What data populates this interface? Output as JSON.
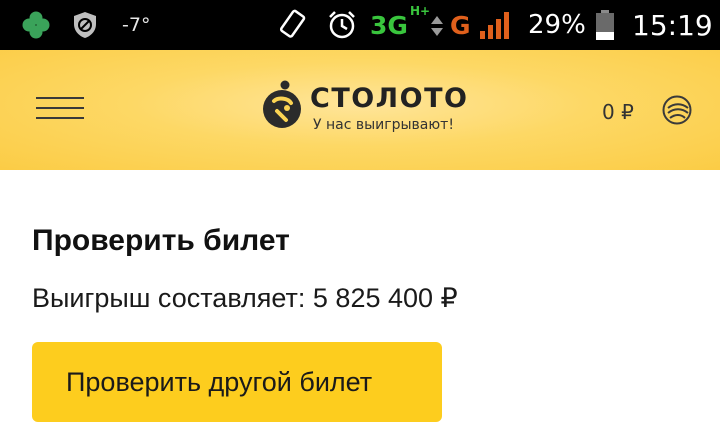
{
  "status_bar": {
    "temperature": "-7°",
    "network_type": "3G",
    "network_subtype": "H+",
    "secondary_network": "G",
    "battery_percent": "29%",
    "battery_level": 0.29,
    "time": "15:19",
    "icons": [
      "clover-icon",
      "vpn-shield-icon",
      "screen-rotation-icon",
      "alarm-clock-icon",
      "data-arrows-icon",
      "signal-bars-icon",
      "battery-icon"
    ]
  },
  "header": {
    "brand_name": "СТОЛОТО",
    "tagline": "У нас выигрывают!",
    "balance": "0 ₽",
    "icons": [
      "menu-icon",
      "stoloto-logo-icon",
      "account-icon"
    ]
  },
  "main": {
    "title": "Проверить билет",
    "prize_text": "Выигрыш составляет: 5 825 400 ₽",
    "check_another_button": "Проверить другой билет"
  },
  "colors": {
    "status_bar_bg": "#000000",
    "header_yellow": "#fbcc45",
    "button_yellow": "#fdcd1e",
    "network_green": "#39c53d",
    "network_orange": "#e0601c"
  }
}
